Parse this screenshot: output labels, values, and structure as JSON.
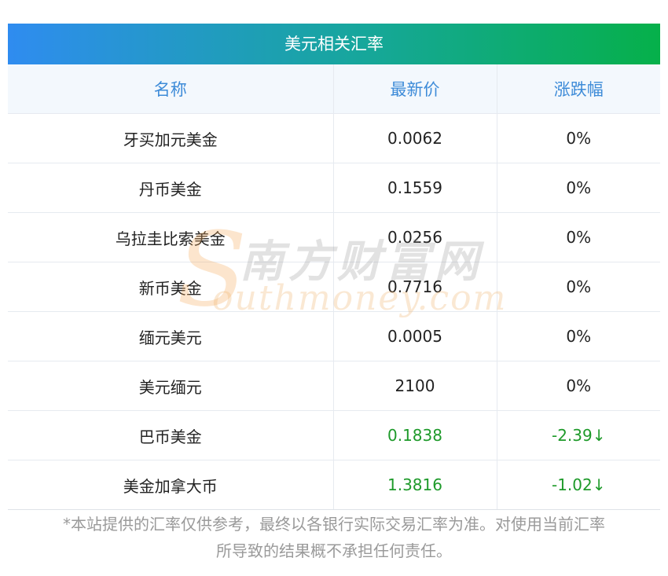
{
  "table_title": "美元相关汇率",
  "columns": [
    "名称",
    "最新价",
    "涨跌幅"
  ],
  "rows": [
    {
      "name": "牙买加元美金",
      "price": "0.0062",
      "change": "0%"
    },
    {
      "name": "丹币美金",
      "price": "0.1559",
      "change": "0%"
    },
    {
      "name": "乌拉圭比索美金",
      "price": "0.0256",
      "change": "0%"
    },
    {
      "name": "新币美金",
      "price": "0.7716",
      "change": "0%"
    },
    {
      "name": "缅元美元",
      "price": "0.0005",
      "change": "0%"
    },
    {
      "name": "美元缅元",
      "price": "2100",
      "change": "0%"
    },
    {
      "name": "巴币美金",
      "price": "0.1838",
      "change": "-2.39↓"
    },
    {
      "name": "美金加拿大币",
      "price": "1.3816",
      "change": "-1.02↓"
    }
  ],
  "watermark": {
    "cn": "南方财富网",
    "en": "outhmoney.com",
    "s": "S"
  },
  "footnote_line1": "*本站提供的汇率仅供参考，最终以各银行实际交易汇率为准。对使用当前汇率",
  "footnote_line2": "所导致的结果概不承担任何责任。",
  "colors": {
    "header_text": "#3d8bd8",
    "down": "#1e9a2a",
    "gradient_start": "#2f8cf0",
    "gradient_end": "#06b04a"
  }
}
